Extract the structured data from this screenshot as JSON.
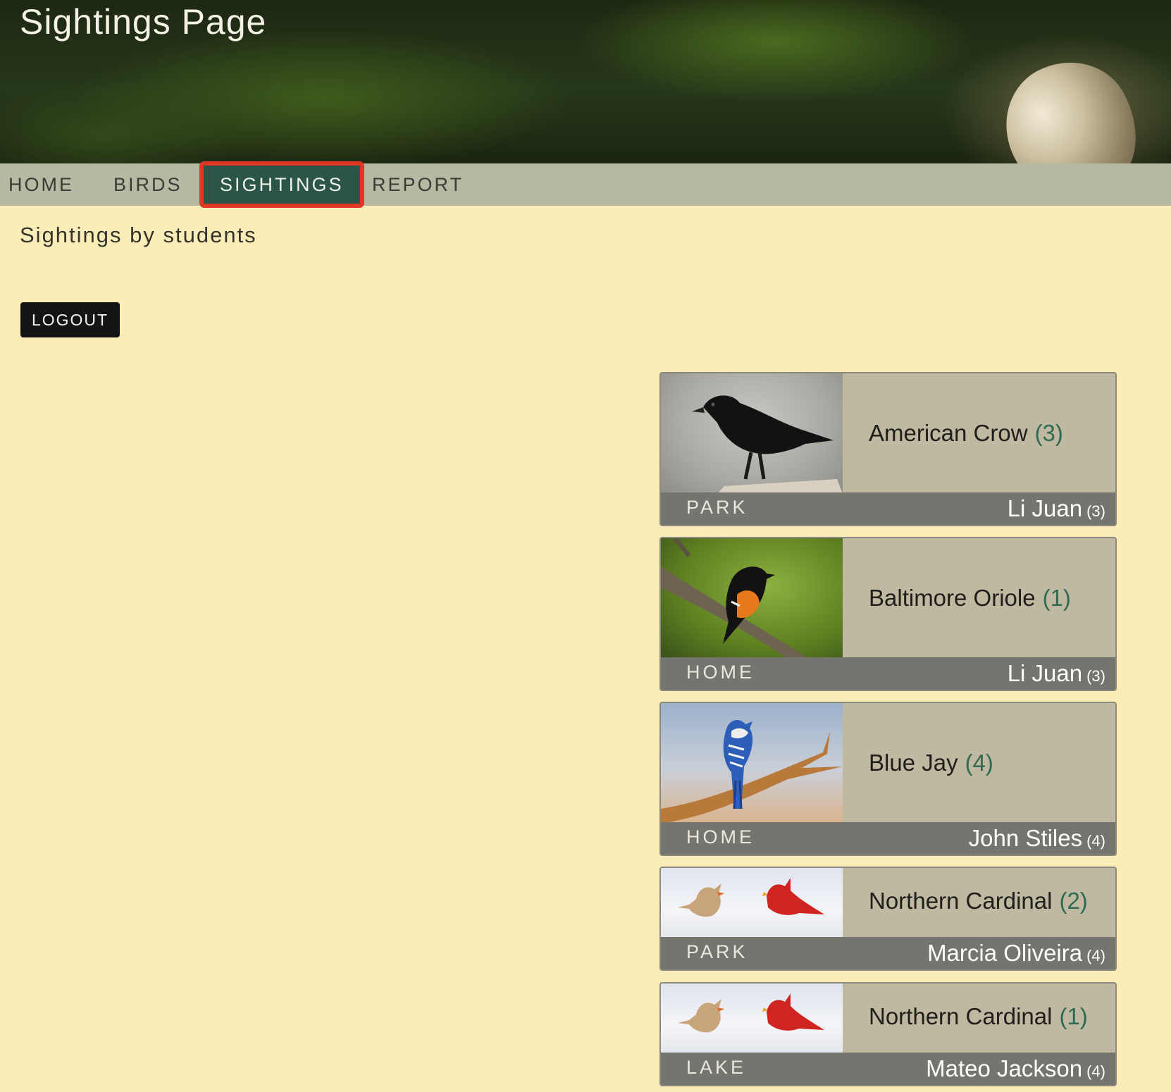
{
  "header": {
    "title": "Sightings Page"
  },
  "nav": {
    "items": [
      {
        "label": "HOME"
      },
      {
        "label": "BIRDS"
      },
      {
        "label": "SIGHTINGS",
        "active": true
      },
      {
        "label": "REPORT"
      }
    ]
  },
  "main": {
    "subtitle": "Sightings by students",
    "logout_label": "LOGOUT"
  },
  "sightings": [
    {
      "bird": "American Crow",
      "count": "(3)",
      "location": "PARK",
      "student": "Li Juan",
      "student_count": "(3)",
      "photo": "american-crow-photo"
    },
    {
      "bird": "Baltimore Oriole",
      "count": "(1)",
      "location": "HOME",
      "student": "Li Juan",
      "student_count": "(3)",
      "photo": "baltimore-oriole-photo"
    },
    {
      "bird": "Blue Jay",
      "count": "(4)",
      "location": "HOME",
      "student": "John Stiles",
      "student_count": "(4)",
      "photo": "blue-jay-photo"
    },
    {
      "bird": "Northern Cardinal",
      "count": "(2)",
      "location": "PARK",
      "student": "Marcia Oliveira",
      "student_count": "(4)",
      "photo": "northern-cardinal-photo"
    },
    {
      "bird": "Northern Cardinal",
      "count": "(1)",
      "location": "LAKE",
      "student": "Mateo Jackson",
      "student_count": "(4)",
      "photo": "northern-cardinal-photo"
    }
  ],
  "colors": {
    "page_background": "#fcedb8",
    "nav_background": "#b7b9a3",
    "nav_active": "#2b5548",
    "highlight_outline": "#e03624",
    "card_background": "#bfb9a1",
    "card_footer": "#757570",
    "count_accent": "#2f6b52"
  }
}
